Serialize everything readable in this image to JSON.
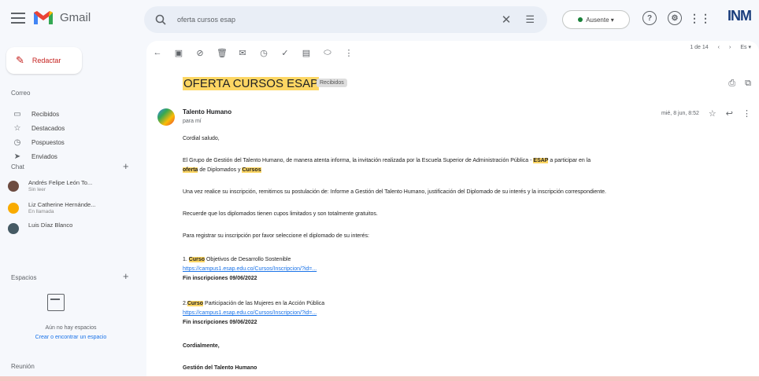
{
  "app": {
    "logo_text": "Gmail",
    "brand_logo": "INM"
  },
  "search": {
    "query": "oferta cursos esap"
  },
  "status": {
    "label": "Ausente"
  },
  "sidebar": {
    "compose_label": "Redactar",
    "section_mail": "Correo",
    "items": [
      {
        "icon": "inbox-icon",
        "label": "Recibidos"
      },
      {
        "icon": "star-icon",
        "label": "Destacados"
      },
      {
        "icon": "clock-icon",
        "label": "Pospuestos"
      },
      {
        "icon": "send-icon",
        "label": "Enviados"
      }
    ],
    "section_chat": "Chat",
    "chats": [
      {
        "name": "Andrés Felipe León To...",
        "sub": "Sin leer"
      },
      {
        "name": "Liz Catherine Hernánde...",
        "sub": "En llamada"
      },
      {
        "name": "Luis Díaz Blanco",
        "sub": ""
      }
    ],
    "section_spaces": "Espacios",
    "spaces_empty": "Aún no hay espacios",
    "spaces_link": "Crear o encontrar un espacio",
    "section_meet": "Reunión"
  },
  "email": {
    "subject_highlight": "OFERTA CURSOS ESAP",
    "label_chip": "Recibidos",
    "sender": "Talento Humano",
    "to_line": "para mí",
    "date": "mié, 8 jun, 8:52",
    "greeting": "Cordial saludo,",
    "para1_a": "El Grupo de Gestión del Talento Humano, de manera atenta informa, la invitación realizada por la Escuela Superior de Administración Pública - ",
    "para1_hl1": "ESAP",
    "para1_b": " a participar en la ",
    "para2_hl1": "oferta",
    "para2_b": " de Diplomados y ",
    "para2_hl2": "Cursos",
    "para3": "Una vez realice su inscripción, remitirnos su postulación de: Informe a Gestión del Talento Humano, justificación del Diplomado de su interés y la inscripción correspondiente.",
    "para4": "Recuerde que los diplomados tienen cupos limitados y son totalmente gratuitos.",
    "para5": "Para registrar su inscripción por favor seleccione el diplomado de su interés:",
    "course1_prefix": "1. ",
    "course1_hl": "Curso",
    "course1_title": " Objetivos de Desarrollo Sostenible",
    "course1_link": "https://campus1.esap.edu.co/Cursos/Inscripcion/?id=...",
    "course1_close": "Fin inscripciones 09/06/2022",
    "course2_prefix": "2.",
    "course2_hl": "Curso",
    "course2_title": " Participación de las Mujeres en la Acción Pública",
    "course2_link": "https://campus1.esap.edu.co/Cursos/Inscripcion/?id=...",
    "course2_close": "Fin inscripciones 09/06/2022",
    "closing": "Cordialmente,",
    "signature": "Gestión del Talento Humano"
  },
  "toolbar": {
    "pager": "1 de 14"
  }
}
